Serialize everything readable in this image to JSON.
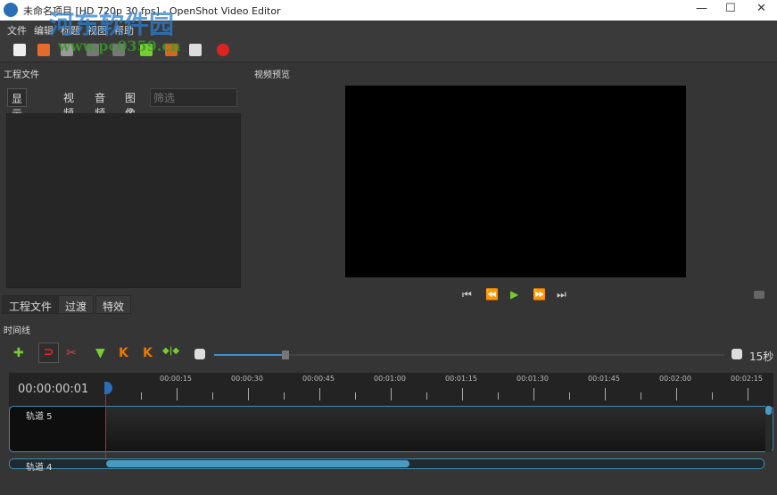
{
  "window": {
    "title": "未命名项目 [HD 720p 30 fps] - OpenShot Video Editor",
    "minimize": "—",
    "maximize": "☐",
    "close": "✕"
  },
  "watermark": {
    "name": "河东软件园",
    "url": "www.pc0359.cn"
  },
  "menu": [
    "文件",
    "编辑",
    "标题",
    "视图",
    "帮助"
  ],
  "project_files": {
    "title": "工程文件",
    "filters": [
      "显示全部",
      "视频",
      "音频",
      "图像"
    ],
    "filter_placeholder": "筛选"
  },
  "bottom_tabs": [
    "工程文件",
    "过渡",
    "特效"
  ],
  "preview": {
    "title": "视频预览",
    "controls": [
      "⏮",
      "⏪",
      "▶",
      "⏩",
      "⏭"
    ]
  },
  "timeline": {
    "title": "时间线",
    "timecode": "00:00:00:01",
    "zoom_label": "15秒",
    "zoom_value": 0.14,
    "ruler": [
      "00:00:15",
      "00:00:30",
      "00:00:45",
      "00:01:00",
      "00:01:15",
      "00:01:30",
      "00:01:45",
      "00:02:00",
      "00:02:15"
    ],
    "tracks": [
      "轨道 5",
      "轨道 4"
    ],
    "scroll_fraction": 0.46
  }
}
